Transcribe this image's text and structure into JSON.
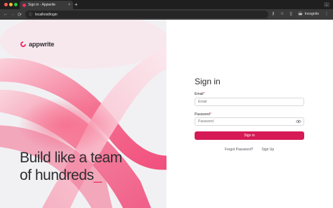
{
  "browser": {
    "tab_title": "Sign in - Appwrite",
    "tab_close": "×",
    "new_tab": "+",
    "tabs_menu": "⌄",
    "back": "←",
    "forward": "→",
    "reload": "⟳",
    "url": "localhost/login",
    "incognito_label": "Incognito",
    "menu": "⋮"
  },
  "brand": {
    "logo_text": "appwrite",
    "accent": "#f02e65"
  },
  "hero": {
    "line1": "Build like a team",
    "line2": "of hundreds",
    "cursor": "_"
  },
  "form": {
    "title": "Sign in",
    "email_label": "Email",
    "email_placeholder": "Email",
    "password_label": "Password",
    "password_placeholder": "Password",
    "required_mark": "*",
    "submit_label": "Sign in",
    "forgot_label": "Forgot Password?",
    "signup_label": "Sign Up"
  }
}
